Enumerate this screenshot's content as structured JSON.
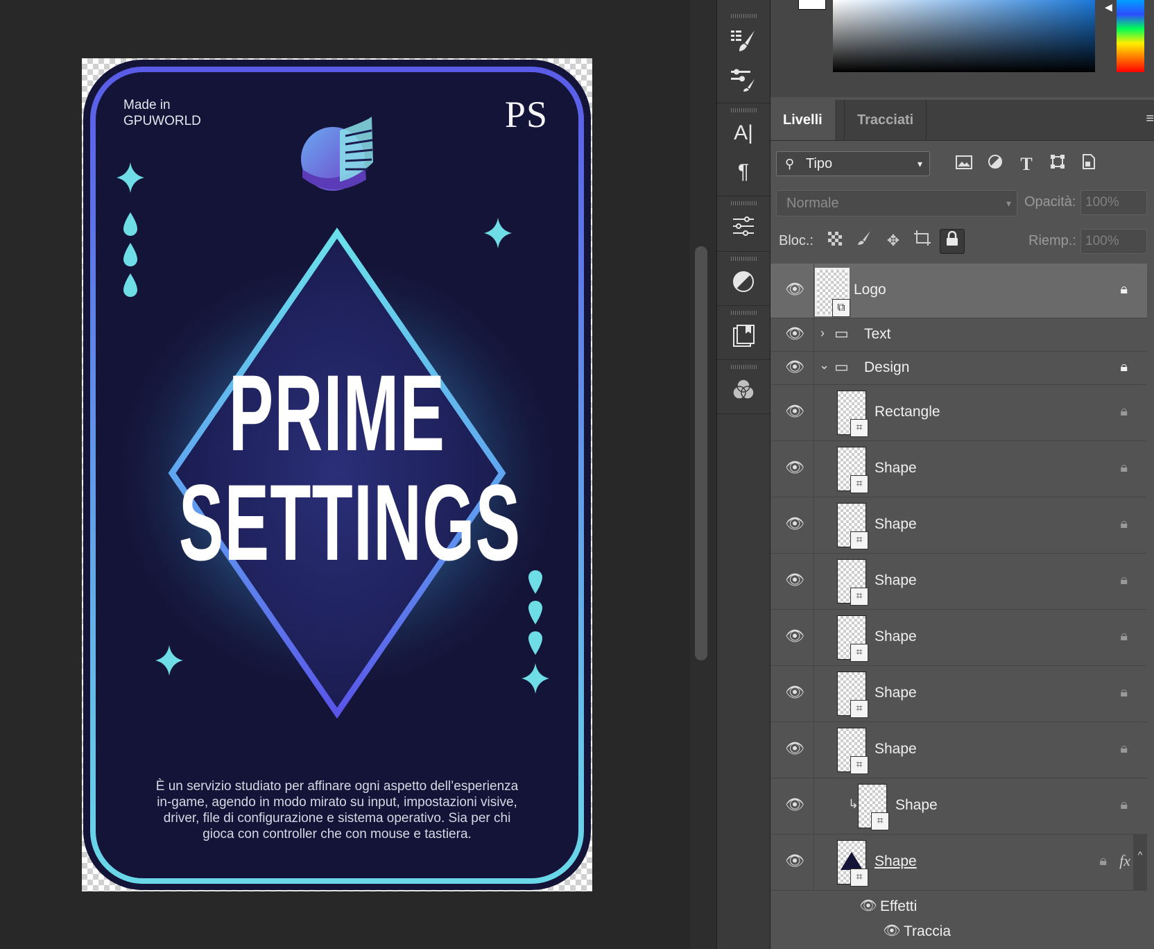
{
  "document": {
    "made_in_line1": "Made in",
    "made_in_line2": "GPUWORLD",
    "ps_mark": "PS",
    "title_line1": "PRIME",
    "title_line2": "SETTINGS",
    "description": "È un servizio studiato per affinare ogni aspetto dell’esperienza in-game, agendo in modo mirato su input, impostazioni visive, driver, file di configurazione e sistema operativo. Sia per chi gioca con controller che con mouse e tastiera."
  },
  "colors": {
    "card_bg": "#141338",
    "frame_top": "#5a5ce8",
    "frame_bottom": "#6ad8e8",
    "accent_cyan": "#6fdde6",
    "workspace": "#282828",
    "panel": "#535353"
  },
  "tools": [
    "properties-brush-icon",
    "adjust-brush-icon",
    "character-icon",
    "paragraph-icon",
    "adjustments-icon",
    "contrast-icon",
    "libraries-icon",
    "channels-icon"
  ],
  "panel": {
    "tabs": [
      "Livelli",
      "Tracciati"
    ],
    "filter_label": "Tipo",
    "blend_mode": "Normale",
    "opacity_label": "Opacità:",
    "opacity_value": "100%",
    "lock_label": "Bloc.:",
    "fill_label": "Riemp.:",
    "fill_value": "100%"
  },
  "layers": [
    {
      "name": "Logo",
      "type": "smart",
      "locked": true,
      "selected": true
    },
    {
      "name": "Text",
      "type": "group-collapsed",
      "locked": false
    },
    {
      "name": "Design",
      "type": "group-expanded",
      "locked": true
    },
    {
      "name": "Rectangle",
      "type": "shape",
      "locked": true
    },
    {
      "name": "Shape",
      "type": "shape",
      "locked": true
    },
    {
      "name": "Shape",
      "type": "shape",
      "locked": true
    },
    {
      "name": "Shape",
      "type": "shape",
      "locked": true
    },
    {
      "name": "Shape",
      "type": "shape",
      "locked": true
    },
    {
      "name": "Shape",
      "type": "shape",
      "locked": true
    },
    {
      "name": "Shape",
      "type": "shape",
      "locked": true
    },
    {
      "name": "Shape",
      "type": "clipped-shape",
      "locked": true
    },
    {
      "name": "Shape",
      "type": "shape-fx",
      "locked": true,
      "fx": "fx"
    }
  ],
  "effects": {
    "label": "Effetti",
    "items": [
      "Traccia"
    ]
  }
}
